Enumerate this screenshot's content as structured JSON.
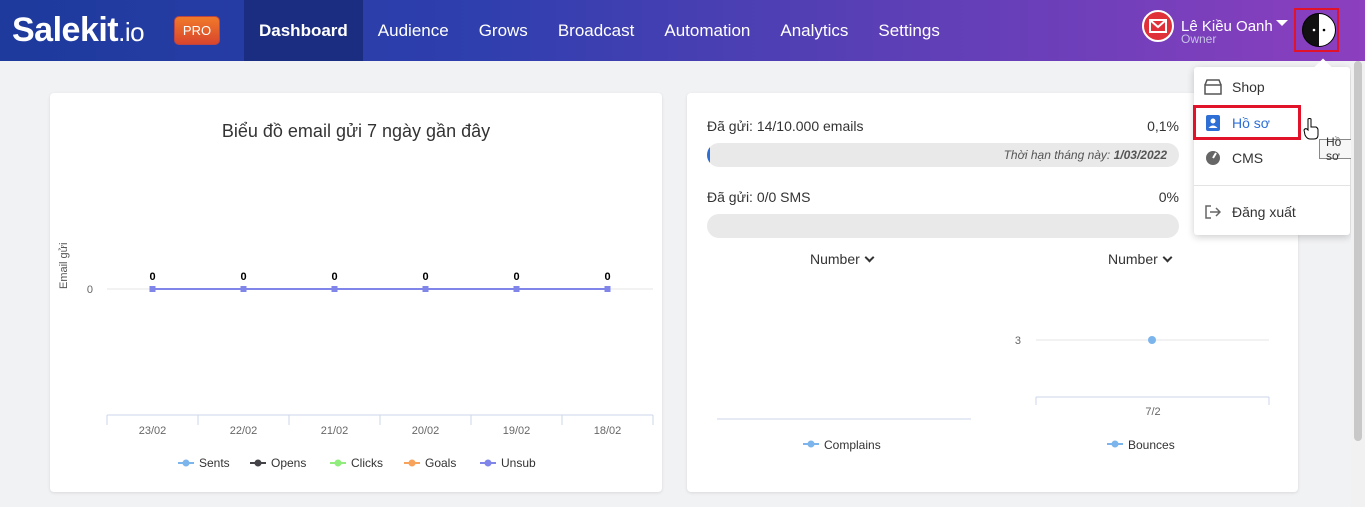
{
  "brand": {
    "logo_main": "Salekit",
    "logo_sub": ".io",
    "badge": "PRO"
  },
  "nav": [
    {
      "label": "Dashboard",
      "active": true
    },
    {
      "label": "Audience"
    },
    {
      "label": "Grows"
    },
    {
      "label": "Broadcast"
    },
    {
      "label": "Automation"
    },
    {
      "label": "Analytics"
    },
    {
      "label": "Settings"
    }
  ],
  "user": {
    "name": "Lê Kiều Oanh",
    "role": "Owner"
  },
  "email_chart": {
    "title": "Biểu đồ email gửi 7 ngày gần đây",
    "ylabel": "Email gửi"
  },
  "stats": {
    "email_label": "Đã gửi: 14/10.000 emails",
    "email_pct": "0,1%",
    "email_fraction": 0.0014,
    "deadline_label": "Thời hạn tháng này:",
    "deadline_date": "1/03/2022",
    "sms_label": "Đã gửi: 0/0 SMS",
    "sms_pct": "0%",
    "sms_fraction": 0
  },
  "selectors": {
    "left": "Number",
    "right": "Number"
  },
  "dropdown": {
    "items": [
      {
        "label": "Shop",
        "icon": "shop-icon"
      },
      {
        "label": "Hồ sơ",
        "icon": "profile-icon"
      },
      {
        "label": "CMS",
        "icon": "cms-icon"
      },
      {
        "label": "Đăng xuất",
        "icon": "logout-icon"
      }
    ]
  },
  "tooltip": "Hồ sơ",
  "colors": {
    "accent": "#2e6fd6",
    "nav_active": "#1a2d80",
    "highlight": "#e0132b"
  },
  "chart_data": [
    {
      "type": "line",
      "title": "Biểu đồ email gửi 7 ngày gần đây",
      "ylabel": "Email gửi",
      "categories": [
        "23/02",
        "22/02",
        "21/02",
        "20/02",
        "19/02",
        "18/02"
      ],
      "yticks": [
        0
      ],
      "series": [
        {
          "name": "Sents",
          "color": "#7cb5ec",
          "values": [
            0,
            0,
            0,
            0,
            0,
            0
          ]
        },
        {
          "name": "Opens",
          "color": "#434348",
          "values": [
            0,
            0,
            0,
            0,
            0,
            0
          ]
        },
        {
          "name": "Clicks",
          "color": "#90ed7d",
          "values": [
            0,
            0,
            0,
            0,
            0,
            0
          ]
        },
        {
          "name": "Goals",
          "color": "#f7a35c",
          "values": [
            0,
            0,
            0,
            0,
            0,
            0
          ]
        },
        {
          "name": "Unsub",
          "color": "#8085e9",
          "values": [
            0,
            0,
            0,
            0,
            0,
            0
          ]
        }
      ],
      "data_labels": [
        "0",
        "0",
        "0",
        "0",
        "0",
        "0"
      ],
      "legend": "bottom"
    },
    {
      "type": "line",
      "categories": [],
      "series": [
        {
          "name": "Complains",
          "color": "#7cb5ec",
          "values": []
        }
      ],
      "legend": "bottom"
    },
    {
      "type": "scatter",
      "categories": [
        "7/2"
      ],
      "yticks": [
        3
      ],
      "series": [
        {
          "name": "Bounces",
          "color": "#7cb5ec",
          "values": [
            3
          ]
        }
      ],
      "legend": "bottom"
    }
  ]
}
